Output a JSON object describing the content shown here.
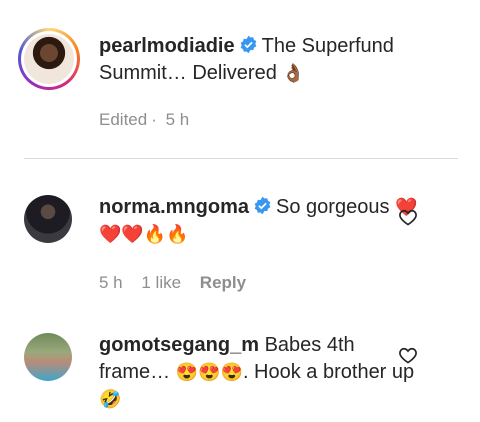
{
  "caption": {
    "username": "pearlmodiadie",
    "text": "The Superfund Summit… Delivered",
    "emoji": "👌🏾",
    "edited": "Edited",
    "time": "5 h"
  },
  "comments": [
    {
      "username": "norma.mngoma",
      "text": "So gorgeous",
      "emoji": "❤️❤️❤️🔥🔥",
      "time": "5 h",
      "likes": "1 like",
      "reply": "Reply"
    },
    {
      "username": "gomotsegang_m",
      "text": "Babes 4th frame…",
      "emoji1": "😍😍😍",
      "text2": ". Hook a brother up",
      "emoji2": "🤣"
    }
  ],
  "colors": {
    "verified": "#3897f0",
    "meta": "#8e8e8e",
    "divider": "#dbdbdb"
  }
}
